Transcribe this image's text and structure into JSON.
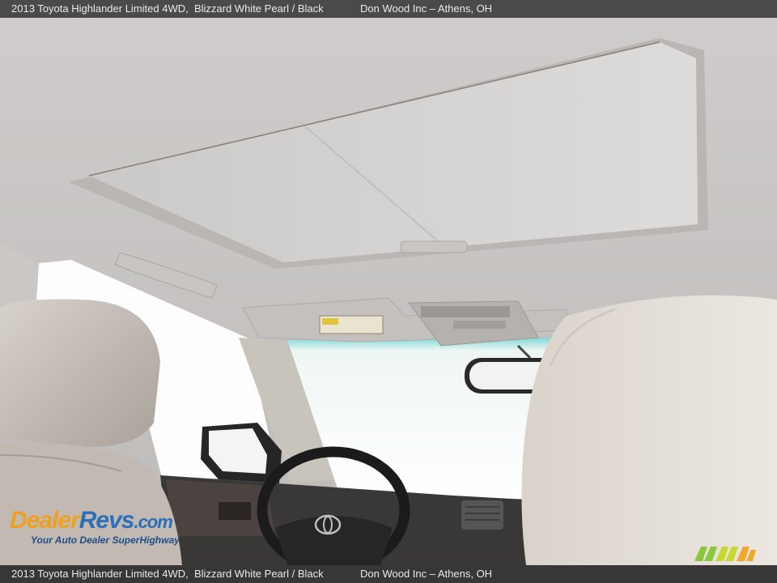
{
  "caption": {
    "title": "2013 Toyota Highlander Limited 4WD,",
    "color": "Blizzard White Pearl / Black",
    "dealer": "Don Wood Inc – Athens, OH"
  },
  "watermark": {
    "brand_part1": "Dealer",
    "brand_part2": "Revs",
    "brand_part3": ".com",
    "tagline": "Your Auto Dealer SuperHighway"
  },
  "colors": {
    "caption_bar": "#4a4a4a",
    "brand_orange": "#f0a020",
    "brand_blue": "#2a6fb8",
    "logo_green": "#8cc63f"
  }
}
